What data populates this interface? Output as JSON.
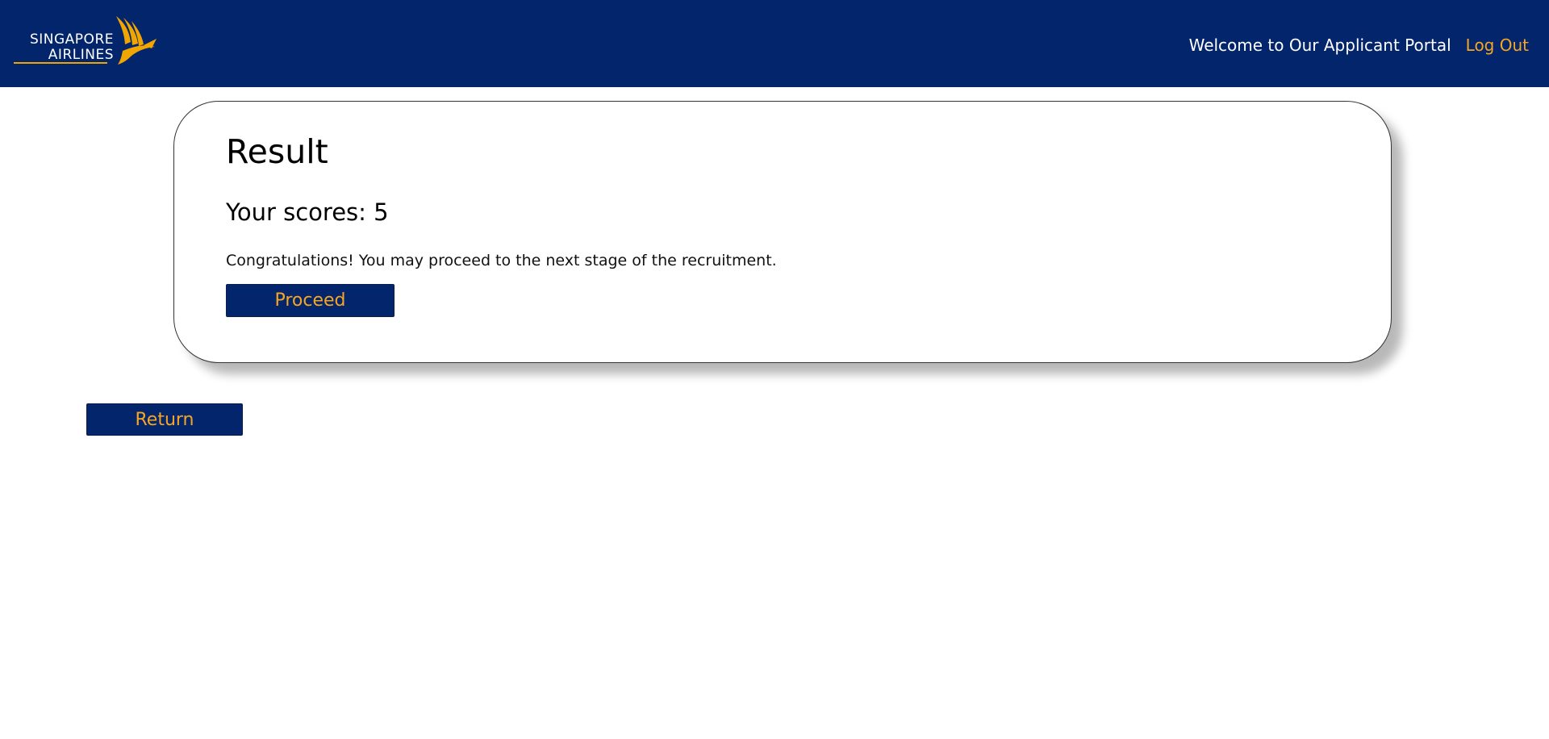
{
  "header": {
    "brand_line1": "SINGAPORE",
    "brand_line2": "AIRLINES",
    "logo_icon": "bird-logo-icon",
    "welcome_text": "Welcome to Our Applicant Portal",
    "logout_label": "Log Out"
  },
  "result": {
    "title": "Result",
    "score_text": "Your scores: 5",
    "message": "Congratulations! You may proceed to the next stage of the recruitment.",
    "proceed_label": "Proceed"
  },
  "footer": {
    "return_label": "Return"
  },
  "colors": {
    "brand_navy": "#03256c",
    "accent_gold": "#f6a623",
    "text": "#000000"
  }
}
